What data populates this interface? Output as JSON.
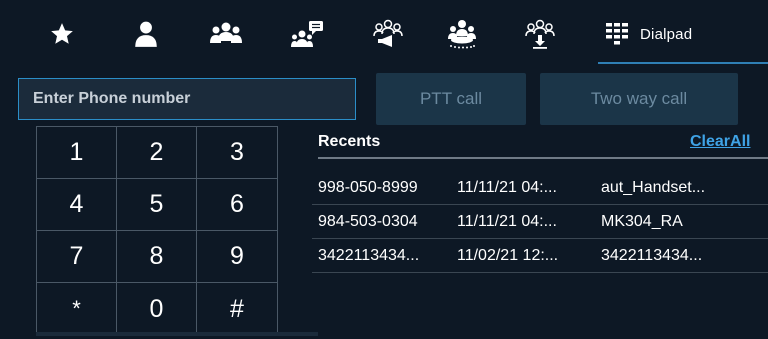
{
  "tabs": [
    {
      "name": "favorites",
      "icon": "star-icon"
    },
    {
      "name": "contacts",
      "icon": "person-icon"
    },
    {
      "name": "groups",
      "icon": "group-icon"
    },
    {
      "name": "group-messages",
      "icon": "group-chat-icon"
    },
    {
      "name": "broadcast",
      "icon": "broadcast-group-icon"
    },
    {
      "name": "conference",
      "icon": "conference-icon"
    },
    {
      "name": "download-group",
      "icon": "group-download-icon"
    },
    {
      "name": "dialpad",
      "icon": "dialpad-icon",
      "label": "Dialpad",
      "active": true
    }
  ],
  "phone_input": {
    "placeholder": "Enter Phone number",
    "value": ""
  },
  "buttons": {
    "ptt_label": "PTT call",
    "two_way_label": "Two way call"
  },
  "keypad": {
    "keys": [
      "1",
      "2",
      "3",
      "4",
      "5",
      "6",
      "7",
      "8",
      "9",
      "*",
      "0",
      "#"
    ]
  },
  "recents": {
    "title": "Recents",
    "clear_label": "ClearAll",
    "rows": [
      {
        "number": "998-050-8999",
        "time": "11/11/21 04:...",
        "name": "aut_Handset..."
      },
      {
        "number": "984-503-0304",
        "time": "11/11/21 04:...",
        "name": "MK304_RA"
      },
      {
        "number": "3422113434...",
        "time": "11/02/21 12:...",
        "name": "3422113434..."
      }
    ]
  },
  "colors": {
    "background": "#0d1825",
    "accent": "#2b8ec8",
    "link": "#3fa3e6",
    "button_bg": "#1b3548",
    "button_text": "#6c8aa0"
  }
}
